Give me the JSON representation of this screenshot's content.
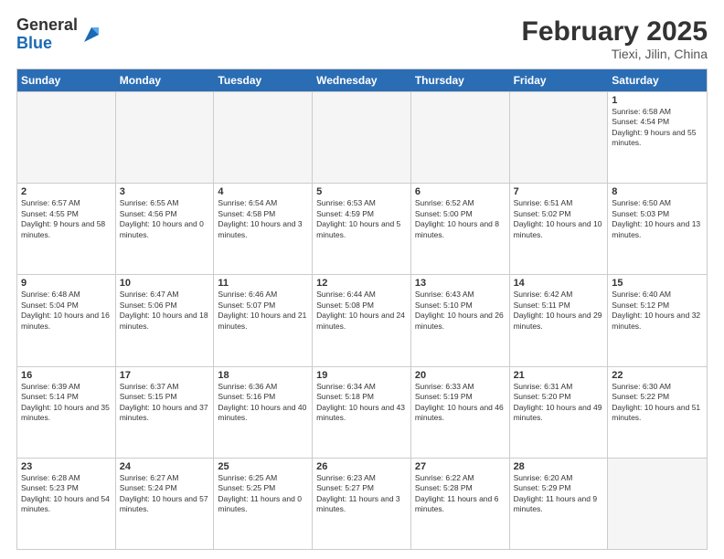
{
  "header": {
    "logo_general": "General",
    "logo_blue": "Blue",
    "month_title": "February 2025",
    "location": "Tiexi, Jilin, China"
  },
  "weekdays": [
    "Sunday",
    "Monday",
    "Tuesday",
    "Wednesday",
    "Thursday",
    "Friday",
    "Saturday"
  ],
  "rows": [
    [
      {
        "day": "",
        "text": ""
      },
      {
        "day": "",
        "text": ""
      },
      {
        "day": "",
        "text": ""
      },
      {
        "day": "",
        "text": ""
      },
      {
        "day": "",
        "text": ""
      },
      {
        "day": "",
        "text": ""
      },
      {
        "day": "1",
        "text": "Sunrise: 6:58 AM\nSunset: 4:54 PM\nDaylight: 9 hours and 55 minutes."
      }
    ],
    [
      {
        "day": "2",
        "text": "Sunrise: 6:57 AM\nSunset: 4:55 PM\nDaylight: 9 hours and 58 minutes."
      },
      {
        "day": "3",
        "text": "Sunrise: 6:55 AM\nSunset: 4:56 PM\nDaylight: 10 hours and 0 minutes."
      },
      {
        "day": "4",
        "text": "Sunrise: 6:54 AM\nSunset: 4:58 PM\nDaylight: 10 hours and 3 minutes."
      },
      {
        "day": "5",
        "text": "Sunrise: 6:53 AM\nSunset: 4:59 PM\nDaylight: 10 hours and 5 minutes."
      },
      {
        "day": "6",
        "text": "Sunrise: 6:52 AM\nSunset: 5:00 PM\nDaylight: 10 hours and 8 minutes."
      },
      {
        "day": "7",
        "text": "Sunrise: 6:51 AM\nSunset: 5:02 PM\nDaylight: 10 hours and 10 minutes."
      },
      {
        "day": "8",
        "text": "Sunrise: 6:50 AM\nSunset: 5:03 PM\nDaylight: 10 hours and 13 minutes."
      }
    ],
    [
      {
        "day": "9",
        "text": "Sunrise: 6:48 AM\nSunset: 5:04 PM\nDaylight: 10 hours and 16 minutes."
      },
      {
        "day": "10",
        "text": "Sunrise: 6:47 AM\nSunset: 5:06 PM\nDaylight: 10 hours and 18 minutes."
      },
      {
        "day": "11",
        "text": "Sunrise: 6:46 AM\nSunset: 5:07 PM\nDaylight: 10 hours and 21 minutes."
      },
      {
        "day": "12",
        "text": "Sunrise: 6:44 AM\nSunset: 5:08 PM\nDaylight: 10 hours and 24 minutes."
      },
      {
        "day": "13",
        "text": "Sunrise: 6:43 AM\nSunset: 5:10 PM\nDaylight: 10 hours and 26 minutes."
      },
      {
        "day": "14",
        "text": "Sunrise: 6:42 AM\nSunset: 5:11 PM\nDaylight: 10 hours and 29 minutes."
      },
      {
        "day": "15",
        "text": "Sunrise: 6:40 AM\nSunset: 5:12 PM\nDaylight: 10 hours and 32 minutes."
      }
    ],
    [
      {
        "day": "16",
        "text": "Sunrise: 6:39 AM\nSunset: 5:14 PM\nDaylight: 10 hours and 35 minutes."
      },
      {
        "day": "17",
        "text": "Sunrise: 6:37 AM\nSunset: 5:15 PM\nDaylight: 10 hours and 37 minutes."
      },
      {
        "day": "18",
        "text": "Sunrise: 6:36 AM\nSunset: 5:16 PM\nDaylight: 10 hours and 40 minutes."
      },
      {
        "day": "19",
        "text": "Sunrise: 6:34 AM\nSunset: 5:18 PM\nDaylight: 10 hours and 43 minutes."
      },
      {
        "day": "20",
        "text": "Sunrise: 6:33 AM\nSunset: 5:19 PM\nDaylight: 10 hours and 46 minutes."
      },
      {
        "day": "21",
        "text": "Sunrise: 6:31 AM\nSunset: 5:20 PM\nDaylight: 10 hours and 49 minutes."
      },
      {
        "day": "22",
        "text": "Sunrise: 6:30 AM\nSunset: 5:22 PM\nDaylight: 10 hours and 51 minutes."
      }
    ],
    [
      {
        "day": "23",
        "text": "Sunrise: 6:28 AM\nSunset: 5:23 PM\nDaylight: 10 hours and 54 minutes."
      },
      {
        "day": "24",
        "text": "Sunrise: 6:27 AM\nSunset: 5:24 PM\nDaylight: 10 hours and 57 minutes."
      },
      {
        "day": "25",
        "text": "Sunrise: 6:25 AM\nSunset: 5:25 PM\nDaylight: 11 hours and 0 minutes."
      },
      {
        "day": "26",
        "text": "Sunrise: 6:23 AM\nSunset: 5:27 PM\nDaylight: 11 hours and 3 minutes."
      },
      {
        "day": "27",
        "text": "Sunrise: 6:22 AM\nSunset: 5:28 PM\nDaylight: 11 hours and 6 minutes."
      },
      {
        "day": "28",
        "text": "Sunrise: 6:20 AM\nSunset: 5:29 PM\nDaylight: 11 hours and 9 minutes."
      },
      {
        "day": "",
        "text": ""
      }
    ]
  ]
}
